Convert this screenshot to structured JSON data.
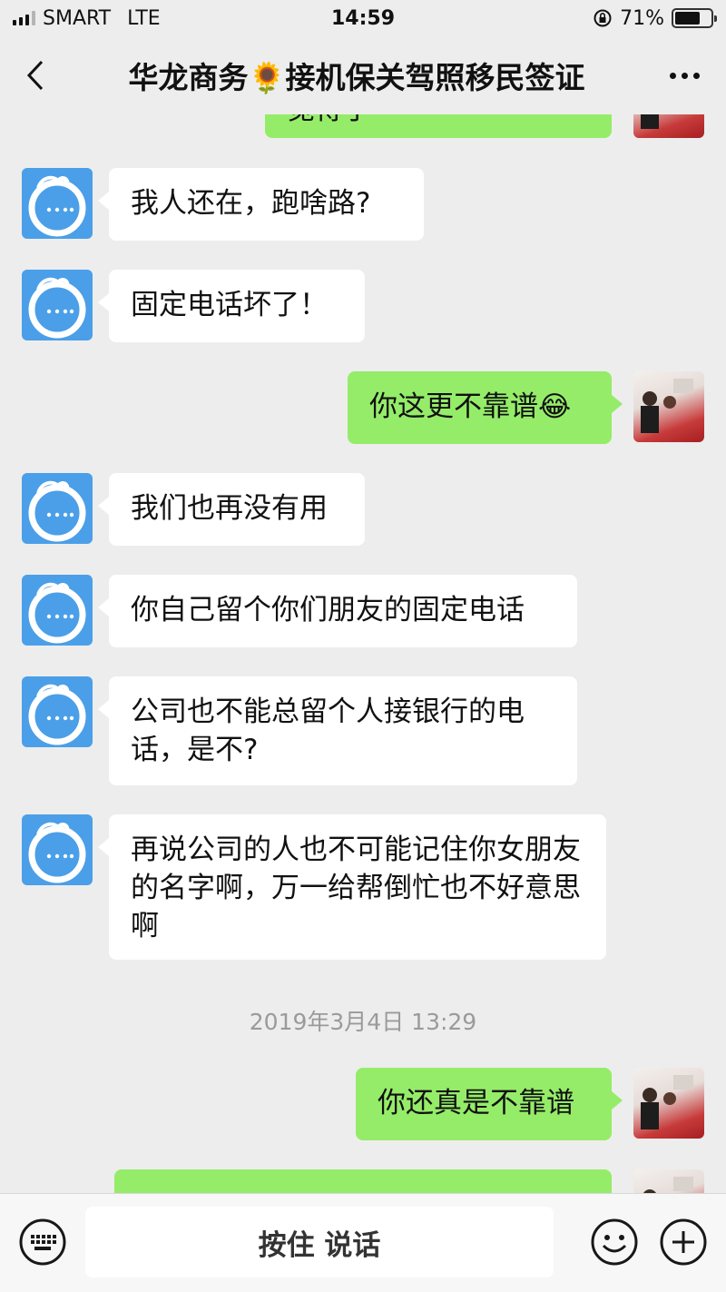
{
  "status_bar": {
    "carrier": "SMART",
    "network": "LTE",
    "time": "14:59",
    "battery_percent": "71%",
    "battery_level": 0.71
  },
  "header": {
    "title": "华龙商务🌻接机保关驾照移民签证"
  },
  "messages": [
    {
      "side": "right",
      "text": "觉得了"
    },
    {
      "side": "left",
      "text": "我人还在，跑啥路?"
    },
    {
      "side": "left",
      "text": "固定电话坏了！"
    },
    {
      "side": "right",
      "text": "你这更不靠谱😂"
    },
    {
      "side": "left",
      "text": "我们也再没有用"
    },
    {
      "side": "left",
      "text": "你自己留个你们朋友的固定电话"
    },
    {
      "side": "left",
      "text": "公司也不能总留个人接银行的电话，是不?"
    },
    {
      "side": "left",
      "text": "再说公司的人也不可能记住你女朋友的名字啊，万一给帮倒忙也不好意思啊"
    },
    {
      "side": "right",
      "text": "你还真是不靠谱"
    }
  ],
  "timestamp": "2019年3月4日 13:29",
  "input_bar": {
    "voice_label": "按住 说话"
  },
  "colors": {
    "background": "#ededed",
    "bubble_right": "#95ec69",
    "bubble_left": "#ffffff",
    "avatar_blue": "#4a9fe8"
  }
}
